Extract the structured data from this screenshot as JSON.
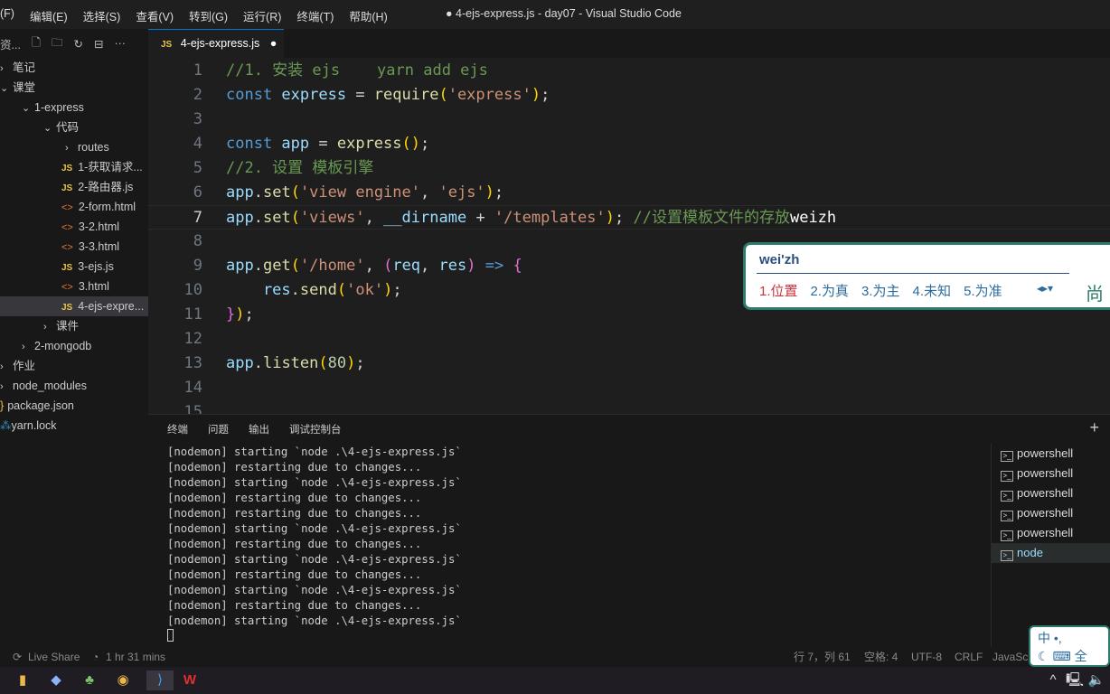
{
  "menu": [
    "(F)",
    "编辑(E)",
    "选择(S)",
    "查看(V)",
    "转到(G)",
    "运行(R)",
    "终端(T)",
    "帮助(H)"
  ],
  "window_title": "● 4-ejs-express.js - day07 - Visual Studio Code",
  "explorer": {
    "title": "资...",
    "items": [
      {
        "label": "笔记",
        "depth": 0,
        "type": "folder",
        "open": false
      },
      {
        "label": "课堂",
        "depth": 0,
        "type": "folder",
        "open": true
      },
      {
        "label": "1-express",
        "depth": 1,
        "type": "folder",
        "open": true
      },
      {
        "label": "代码",
        "depth": 2,
        "type": "folder",
        "open": true
      },
      {
        "label": "routes",
        "depth": 3,
        "type": "folder",
        "open": false
      },
      {
        "label": "1-获取请求...",
        "depth": 3,
        "type": "js"
      },
      {
        "label": "2-路由器.js",
        "depth": 3,
        "type": "js"
      },
      {
        "label": "2-form.html",
        "depth": 3,
        "type": "html"
      },
      {
        "label": "3-2.html",
        "depth": 3,
        "type": "html"
      },
      {
        "label": "3-3.html",
        "depth": 3,
        "type": "html"
      },
      {
        "label": "3-ejs.js",
        "depth": 3,
        "type": "js"
      },
      {
        "label": "3.html",
        "depth": 3,
        "type": "html"
      },
      {
        "label": "4-ejs-expre...",
        "depth": 3,
        "type": "js",
        "selected": true
      },
      {
        "label": "课件",
        "depth": 2,
        "type": "folder",
        "open": false
      },
      {
        "label": "2-mongodb",
        "depth": 1,
        "type": "folder",
        "open": false
      },
      {
        "label": "作业",
        "depth": 0,
        "type": "folder",
        "open": false
      },
      {
        "label": "node_modules",
        "depth": 0,
        "type": "folder",
        "open": false
      },
      {
        "label": "package.json",
        "depth": 0,
        "type": "json"
      },
      {
        "label": "yarn.lock",
        "depth": 0,
        "type": "yarn"
      }
    ]
  },
  "tab": {
    "icon": "JS",
    "label": "4-ejs-express.js",
    "modified": true
  },
  "code": [
    [
      [
        "//1. 安装 ejs    yarn add ejs",
        "cm"
      ]
    ],
    [
      [
        "const ",
        "kw"
      ],
      [
        "express",
        "var"
      ],
      [
        " = ",
        "pl"
      ],
      [
        "require",
        "fn"
      ],
      [
        "(",
        "br"
      ],
      [
        "'express'",
        "str"
      ],
      [
        ")",
        "br"
      ],
      [
        ";",
        "pl"
      ]
    ],
    [],
    [
      [
        "const ",
        "kw"
      ],
      [
        "app",
        "var"
      ],
      [
        " = ",
        "pl"
      ],
      [
        "express",
        "fn"
      ],
      [
        "()",
        "br"
      ],
      [
        ";",
        "pl"
      ]
    ],
    [
      [
        "//2. 设置 模板引擎",
        "cm"
      ]
    ],
    [
      [
        "app",
        "var"
      ],
      [
        ".",
        "pl"
      ],
      [
        "set",
        "fn"
      ],
      [
        "(",
        "br"
      ],
      [
        "'view engine'",
        "str"
      ],
      [
        ", ",
        "pl"
      ],
      [
        "'ejs'",
        "str"
      ],
      [
        ")",
        "br"
      ],
      [
        ";",
        "pl"
      ]
    ],
    [
      [
        "app",
        "var"
      ],
      [
        ".",
        "pl"
      ],
      [
        "set",
        "fn"
      ],
      [
        "(",
        "br"
      ],
      [
        "'views'",
        "str"
      ],
      [
        ", ",
        "pl"
      ],
      [
        "__dirname",
        "var"
      ],
      [
        " + ",
        "pl"
      ],
      [
        "'/templates'",
        "str"
      ],
      [
        ")",
        "br"
      ],
      [
        "; ",
        "pl"
      ],
      [
        "//设置模板文件的存放",
        "cm"
      ],
      [
        "weizh",
        "wh"
      ]
    ],
    [],
    [
      [
        "app",
        "var"
      ],
      [
        ".",
        "pl"
      ],
      [
        "get",
        "fn"
      ],
      [
        "(",
        "br"
      ],
      [
        "'/home'",
        "str"
      ],
      [
        ", ",
        "pl"
      ],
      [
        "(",
        "br2"
      ],
      [
        "req",
        "var"
      ],
      [
        ", ",
        "pl"
      ],
      [
        "res",
        "var"
      ],
      [
        ")",
        "br2"
      ],
      [
        " => ",
        "kw"
      ],
      [
        "{",
        "br2"
      ]
    ],
    [
      [
        "    res",
        "var"
      ],
      [
        ".",
        "pl"
      ],
      [
        "send",
        "fn"
      ],
      [
        "(",
        "br"
      ],
      [
        "'ok'",
        "str"
      ],
      [
        ")",
        "br"
      ],
      [
        ";",
        "pl"
      ]
    ],
    [
      [
        "}",
        "br2"
      ],
      [
        ")",
        "br"
      ],
      [
        ";",
        "pl"
      ]
    ],
    [],
    [
      [
        "app",
        "var"
      ],
      [
        ".",
        "pl"
      ],
      [
        "listen",
        "fn"
      ],
      [
        "(",
        "br"
      ],
      [
        "80",
        "num"
      ],
      [
        ")",
        "br"
      ],
      [
        ";",
        "pl"
      ]
    ],
    [],
    []
  ],
  "current_line": 7,
  "ime": {
    "composition": "wei'zh",
    "candidates": [
      "1.位置",
      "2.为真",
      "3.为主",
      "4.未知",
      "5.为准"
    ],
    "brand": "尚"
  },
  "panel": {
    "tabs": [
      "终端",
      "问题",
      "输出",
      "调试控制台"
    ],
    "terminal_lines": [
      "[nodemon] starting `node .\\4-ejs-express.js`",
      "[nodemon] restarting due to changes...",
      "[nodemon] starting `node .\\4-ejs-express.js`",
      "[nodemon] restarting due to changes...",
      "[nodemon] restarting due to changes...",
      "[nodemon] starting `node .\\4-ejs-express.js`",
      "[nodemon] restarting due to changes...",
      "[nodemon] starting `node .\\4-ejs-express.js`",
      "[nodemon] restarting due to changes...",
      "[nodemon] starting `node .\\4-ejs-express.js`",
      "[nodemon] restarting due to changes...",
      "[nodemon] starting `node .\\4-ejs-express.js`"
    ],
    "terminals": [
      "powershell",
      "powershell",
      "powershell",
      "powershell",
      "powershell",
      "node"
    ],
    "active_terminal": 5
  },
  "status": {
    "live_share": "Live Share",
    "time": "1 hr 31 mins",
    "position": "行 7，列 61",
    "spaces": "空格: 4",
    "encoding": "UTF-8",
    "eol": "CRLF",
    "language": "JavaSc"
  },
  "ime_bar": {
    "row1": "中 •,",
    "row2": "全"
  }
}
